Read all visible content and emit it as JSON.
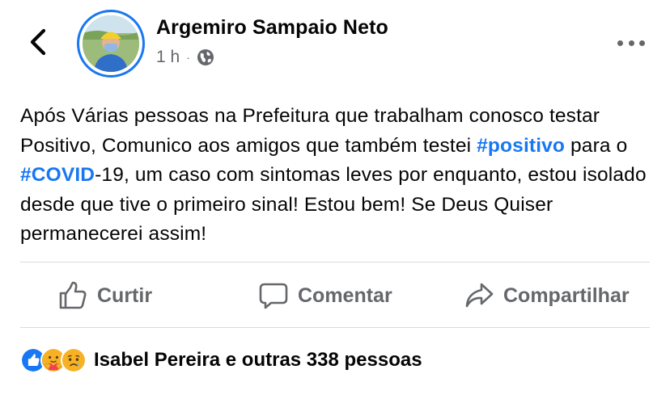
{
  "post": {
    "author": "Argemiro Sampaio Neto",
    "time": "1 h",
    "separator": "·",
    "privacy_icon": "globe-icon",
    "text": {
      "p1": "Após Várias pessoas na Prefeitura que trabalham conosco testar Positivo, Comunico aos amigos que também testei ",
      "hashtag1": "#positivo",
      "p2": " para o ",
      "hashtag2": "#COVID",
      "p3": "-19, um caso com sintomas leves por enquanto, estou isolado desde que tive o primeiro sinal! Estou bem! Se Deus Quiser permanecerei assim!"
    }
  },
  "actions": {
    "like": {
      "label": "Curtir",
      "icon": "thumbs-up-icon"
    },
    "comment": {
      "label": "Comentar",
      "icon": "comment-icon"
    },
    "share": {
      "label": "Compartilhar",
      "icon": "share-icon"
    }
  },
  "reactions": {
    "icons": [
      "like-reaction-icon",
      "care-reaction-icon",
      "sad-reaction-icon"
    ],
    "summary": "Isabel Pereira e outras 338 pessoas"
  },
  "colors": {
    "accent": "#1877f2",
    "secondary_text": "#65676b",
    "primary_text": "#050505"
  }
}
